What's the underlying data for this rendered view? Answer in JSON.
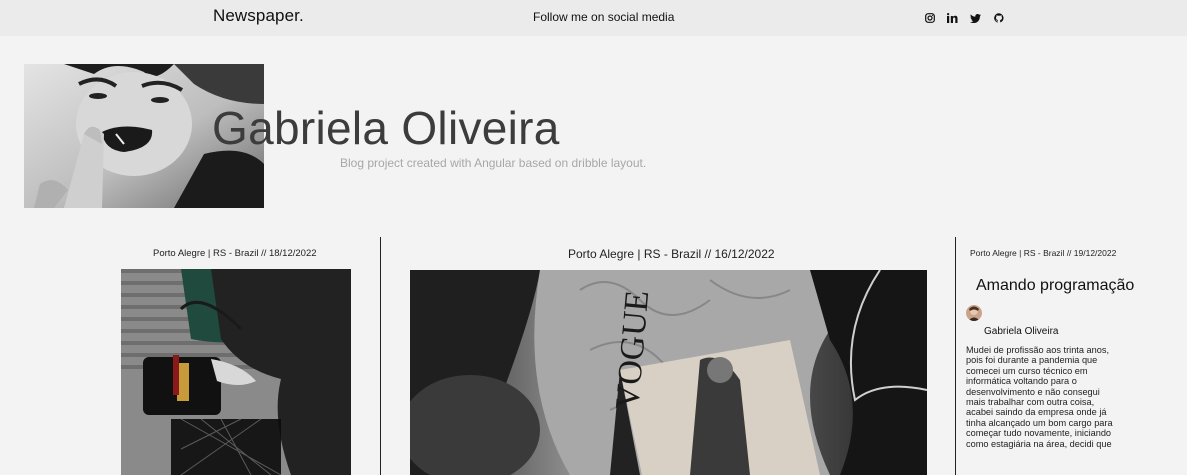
{
  "header": {
    "brand": "Newspaper.",
    "tagline": "Follow me on social media",
    "socials": [
      {
        "icon": "instagram-icon"
      },
      {
        "icon": "linkedin-icon"
      },
      {
        "icon": "twitter-icon"
      },
      {
        "icon": "github-icon"
      }
    ]
  },
  "hero": {
    "name": "Gabriela Oliveira",
    "subtitle": "Blog project created with Angular based on dribble layout."
  },
  "posts": {
    "left": {
      "meta": "Porto Alegre | RS - Brazil // 18/12/2022"
    },
    "middle": {
      "meta": "Porto Alegre | RS - Brazil // 16/12/2022"
    },
    "right": {
      "meta": "Porto Alegre | RS - Brazil // 19/12/2022",
      "title": "Amando programação",
      "author": "Gabriela Oliveira",
      "lines": [
        "Mudei de profissão aos trinta anos,",
        "pois foi durante a pandemia que",
        "comecei um curso técnico em",
        "informática voltando para o",
        "desenvolvimento e não consegui",
        "mais trabalhar com outra coisa,",
        "acabei saindo da empresa onde já",
        "tinha alcançado um bom cargo para",
        "começar tudo novamente, iniciando",
        "como estagiária na área, decidi que"
      ]
    }
  },
  "colors": {
    "background": "#f3f3f3",
    "topbar": "#ebebeb",
    "heroName": "#3c3c3c",
    "subtitle": "#a7a7a7"
  }
}
